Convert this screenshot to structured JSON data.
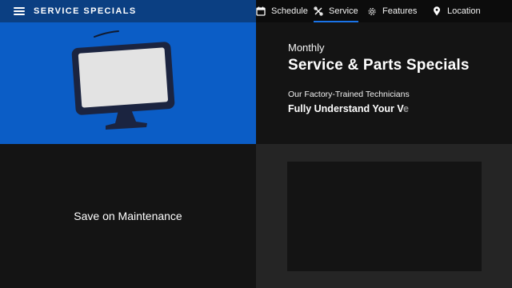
{
  "header": {
    "menu_icon": "hamburger-menu-icon",
    "title": "SERVICE SPECIALS",
    "brand_color": "#0b3f82",
    "active_indicator_color": "#1a73e8"
  },
  "nav": {
    "items": [
      {
        "label": "Schedule",
        "icon": "calendar-icon"
      },
      {
        "label": "Service",
        "icon": "wrench-tools-icon",
        "active": true
      },
      {
        "label": "Features",
        "icon": "gear-icon"
      },
      {
        "label": "Location",
        "icon": "map-pin-icon"
      }
    ]
  },
  "hero": {
    "eyebrow": "Monthly",
    "headline": "Service & Parts Specials",
    "line1": "Our Factory-Trained Technicians",
    "line2_main": "Fully Understand Your V",
    "line2_fade": "e",
    "illustration": "desktop-monitor-icon",
    "panel_color": "#0b5dc6"
  },
  "tiles": {
    "maintenance_label": "Save on Maintenance"
  }
}
